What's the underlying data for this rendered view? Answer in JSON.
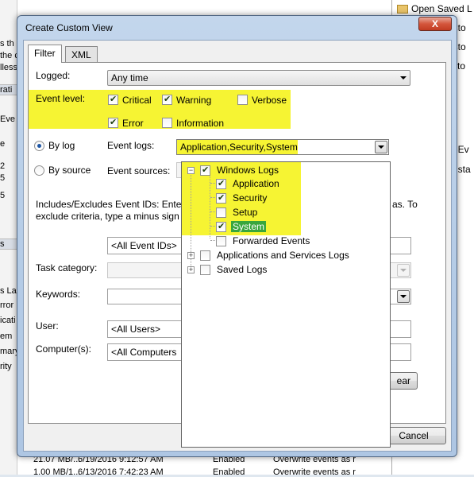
{
  "background": {
    "left_fragments": [
      "s th",
      "the c",
      "lless",
      "rati",
      "Eve",
      "e",
      "2",
      "5",
      "5",
      "s",
      "s Las",
      "rror",
      "icati",
      "em",
      "mary",
      "rity"
    ],
    "right_items": [
      "Open Saved L",
      "usto",
      "usto",
      "to",
      "l-Ev",
      "nsta"
    ],
    "bottom_rows": [
      {
        "size": "21.07 MB/...",
        "date": "6/19/2016 9:12:57 AM",
        "status": "Enabled",
        "policy": "Overwrite events as r"
      },
      {
        "size": "1.00 MB/1...",
        "date": "6/13/2016 7:42:23 AM",
        "status": "Enabled",
        "policy": "Overwrite events as r"
      }
    ]
  },
  "dialog": {
    "title": "Create Custom View",
    "close_label": "X",
    "tabs": [
      {
        "label": "Filter"
      },
      {
        "label": "XML"
      }
    ],
    "logged": {
      "label": "Logged:",
      "value": "Any time"
    },
    "event_level": {
      "label": "Event level:",
      "critical": "Critical",
      "warning": "Warning",
      "verbose": "Verbose",
      "error": "Error",
      "information": "Information"
    },
    "by_log": {
      "label": "By log",
      "event_logs_label": "Event logs:",
      "event_logs_value": "Application,Security,System"
    },
    "by_source": {
      "label": "By source",
      "event_sources_label": "Event sources:"
    },
    "includes_text_1": "Includes/Excludes Event IDs: Enter",
    "includes_text_1_end": "as. To",
    "includes_text_2": "exclude criteria, type a minus sign",
    "event_ids_value": "<All Event IDs>",
    "task_category_label": "Task category:",
    "keywords_label": "Keywords:",
    "user_label": "User:",
    "user_value": "<All Users>",
    "computers_label": "Computer(s):",
    "computers_value": "<All Computers",
    "clear_label": "ear",
    "cancel_label": "Cancel"
  },
  "tree": {
    "windows_logs": "Windows Logs",
    "application": "Application",
    "security": "Security",
    "setup": "Setup",
    "system": "System",
    "forwarded": "Forwarded Events",
    "apps_services": "Applications and Services Logs",
    "saved_logs": "Saved Logs"
  },
  "colors": {
    "highlight": "#f4f100",
    "selection": "#39a63c",
    "dialog_frame": "#b4cbe6"
  }
}
